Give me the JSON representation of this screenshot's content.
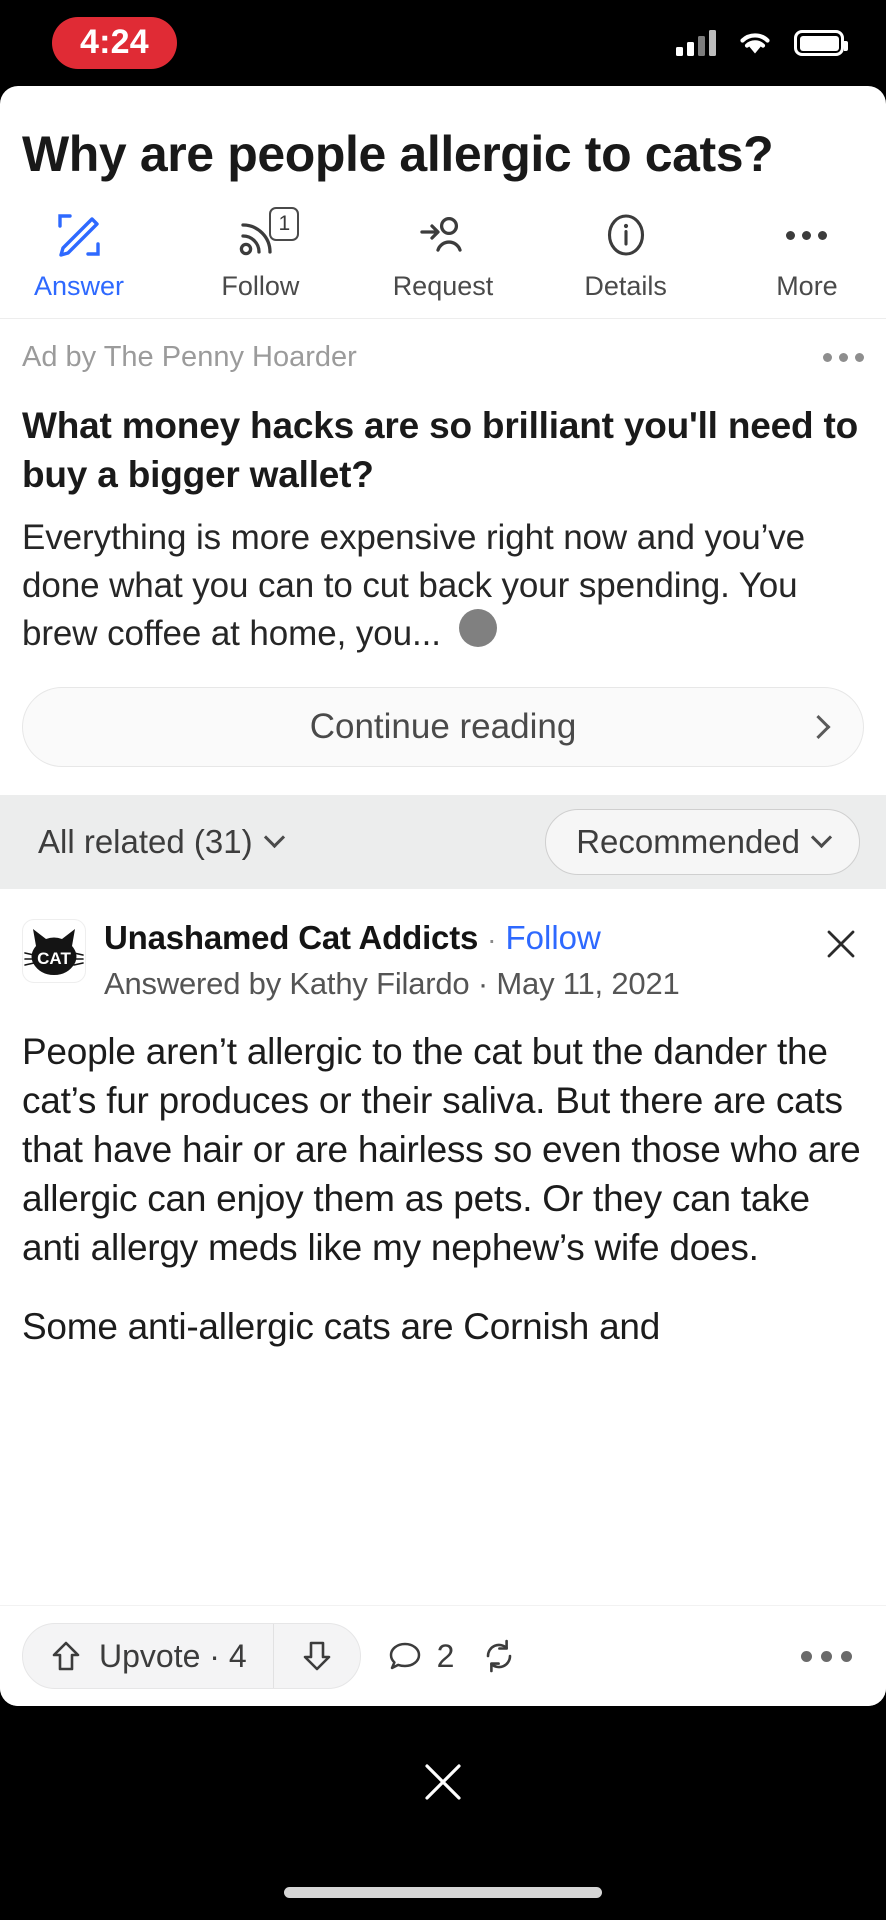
{
  "status_bar": {
    "time": "4:24",
    "time_pill_color": "#e02b35",
    "signal_icon": "cellular-signal-icon",
    "wifi_icon": "wifi-icon",
    "battery_icon": "battery-icon"
  },
  "question": {
    "title": "Why are people allergic to cats?"
  },
  "actions": [
    {
      "label": "Answer",
      "icon": "pencil-write-icon",
      "active": true,
      "badge": null
    },
    {
      "label": "Follow",
      "icon": "rss-follow-icon",
      "active": false,
      "badge": "1"
    },
    {
      "label": "Request",
      "icon": "request-person-icon",
      "active": false,
      "badge": null
    },
    {
      "label": "Details",
      "icon": "info-circle-icon",
      "active": false,
      "badge": null
    },
    {
      "label": "More",
      "icon": "more-dots-icon",
      "active": false,
      "badge": null
    }
  ],
  "ad": {
    "sponsor_label": "Ad by The Penny Hoarder",
    "menu_icon": "ad-overflow-icon",
    "title": "What money hacks are so brilliant you'll need to buy a bigger wallet?",
    "body": "Everything is more expensive right now and you’ve done what you can to cut back your spending. You brew coffee at home, you...",
    "cta_label": "Continue reading",
    "cta_chevron_icon": "chevron-right-icon"
  },
  "filter_bar": {
    "related_label": "All related (31)",
    "related_caret_icon": "chevron-down-icon",
    "sort_label": "Recommended",
    "sort_caret_icon": "chevron-down-icon"
  },
  "answer": {
    "avatar_icon": "cat-head-avatar",
    "avatar_text": "CAT",
    "space_name": "Unashamed Cat Addicts",
    "separator": "·",
    "follow_label": "Follow",
    "close_icon": "close-icon",
    "byline": "Answered by Kathy Filardo  · May 11, 2021",
    "paragraphs": [
      "People aren’t allergic to the cat but the dander the cat’s fur produces or their saliva. But there are cats that have hair or are hairless so even those who are allergic can enjoy them as pets. Or they can take anti allergy meds like my nephew’s wife does.",
      "Some anti-allergic cats are Cornish and"
    ]
  },
  "footer": {
    "upvote_label": "Upvote · 4",
    "upvote_icon": "arrow-up-icon",
    "downvote_icon": "arrow-down-icon",
    "comment_count": "2",
    "comment_icon": "comment-bubble-icon",
    "share_icon": "repost-share-icon",
    "overflow_icon": "more-horizontal-icon"
  },
  "bottom_bar": {
    "close_icon": "close-overlay-icon",
    "home_indicator": "home-indicator"
  },
  "colors": {
    "accent_blue": "#2e69ff",
    "time_red": "#e02b35",
    "filter_bg": "#eceded"
  }
}
